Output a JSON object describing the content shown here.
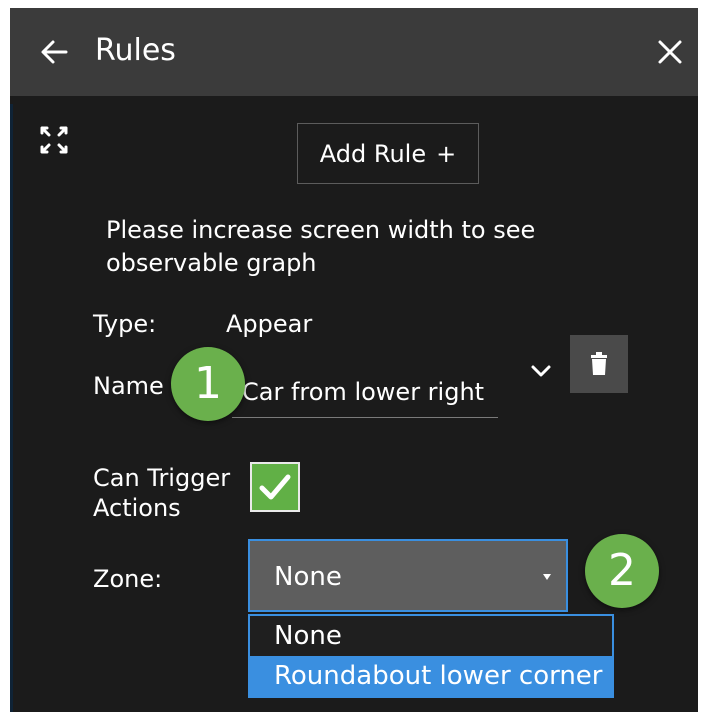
{
  "header": {
    "title": "Rules",
    "back_icon": "arrow-left-icon",
    "close_icon": "close-icon"
  },
  "toolbar": {
    "expand_icon": "expand-icon",
    "add_rule_label": "Add Rule",
    "add_rule_glyph": "+"
  },
  "notice": {
    "message": "Please increase screen width to see observable graph"
  },
  "rule": {
    "type_label": "Type:",
    "type_value": "Appear",
    "name_label": "Name",
    "name_value": "Car from lower right",
    "delete_icon": "trash-icon",
    "dropdown_icon": "chevron-down-icon",
    "can_trigger_label": "Can Trigger Actions",
    "can_trigger_checked": true,
    "zone_label": "Zone:",
    "zone_selected": "None",
    "zone_options": [
      "None",
      "Roundabout lower corner"
    ]
  },
  "callouts": [
    "1",
    "2"
  ],
  "colors": {
    "header_bg": "#3b3b3b",
    "panel_bg": "#1b1b1b",
    "accent_blue": "#3a8fe0",
    "check_green": "#61b046",
    "callout_green": "#6ab04c"
  }
}
